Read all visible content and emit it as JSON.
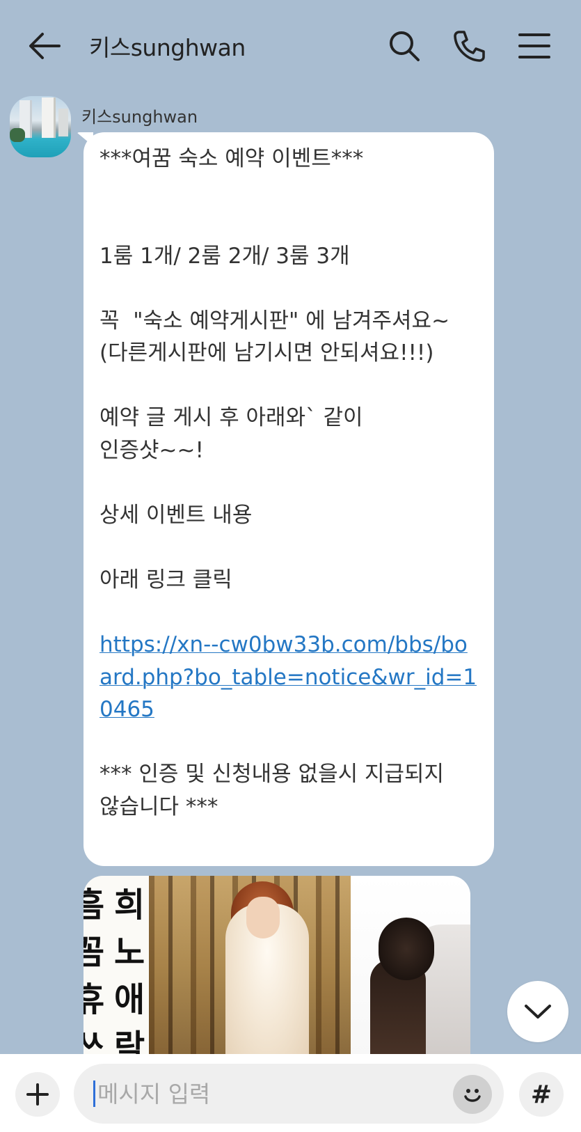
{
  "header": {
    "title": "키스sunghwan",
    "back_icon": "arrow-left-icon",
    "search_icon": "search-icon",
    "call_icon": "phone-icon",
    "menu_icon": "hamburger-menu-icon"
  },
  "message": {
    "sender": "키스sunghwan",
    "avatar_icon": "profile-photo",
    "text_main": "***여꿈 숙소 예약 이벤트***\n\n\n1룸 1개/ 2룸 2개/ 3룸 3개\n\n꼭  \"숙소 예약게시판\" 에 남겨주셔요~\n(다른게시판에 남기시면 안되셔요!!!)\n\n예약 글 게시 후 아래와` 같이\n인증샷~~!\n\n상세 이벤트 내용\n\n아래 링크 클릭\n",
    "link": "https://xn--cw0bw33b.com/bbs/board.php?bo_table=notice&wr_id=10465",
    "text_footer": "*** 인증 및 신청내용 없을시 지급되지\n않습니다 ***"
  },
  "image_message": {
    "strip_col1": "흠\n꼼\n휴\n쓰",
    "strip_col2": "희\n노\n애\n락"
  },
  "scroll_down_icon": "chevron-down-icon",
  "input_bar": {
    "plus_icon": "plus-icon",
    "placeholder": "메시지 입력",
    "emoji_icon": "emoji-icon",
    "hash_label": "#"
  },
  "colors": {
    "background": "#a9bdd1",
    "bubble": "#ffffff",
    "link": "#2477c4",
    "caret": "#2e6fd8"
  }
}
